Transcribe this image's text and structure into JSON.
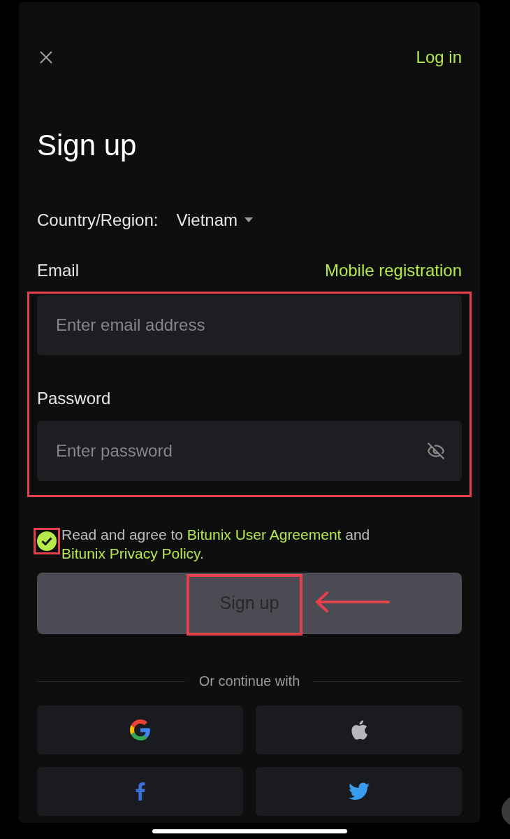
{
  "header": {
    "login": "Log in"
  },
  "title": "Sign up",
  "country": {
    "label": "Country/Region:",
    "value": "Vietnam"
  },
  "email": {
    "label": "Email",
    "switch_link": "Mobile registration",
    "placeholder": "Enter email address"
  },
  "password": {
    "label": "Password",
    "placeholder": "Enter password",
    "visible": false
  },
  "agreement": {
    "checked": true,
    "parts": [
      {
        "kind": "text",
        "text": "Read and agree to "
      },
      {
        "kind": "link",
        "text": "Bitunix User Agreement"
      },
      {
        "kind": "text",
        "text": " and "
      },
      {
        "kind": "link",
        "text": "Bitunix Privacy Policy"
      },
      {
        "kind": "text",
        "text": "."
      }
    ]
  },
  "submit": {
    "label": "Sign up",
    "disabled": true
  },
  "divider": "Or continue with",
  "social": [
    {
      "kind": "google"
    },
    {
      "kind": "apple"
    },
    {
      "kind": "facebook"
    },
    {
      "kind": "twitter"
    }
  ]
}
